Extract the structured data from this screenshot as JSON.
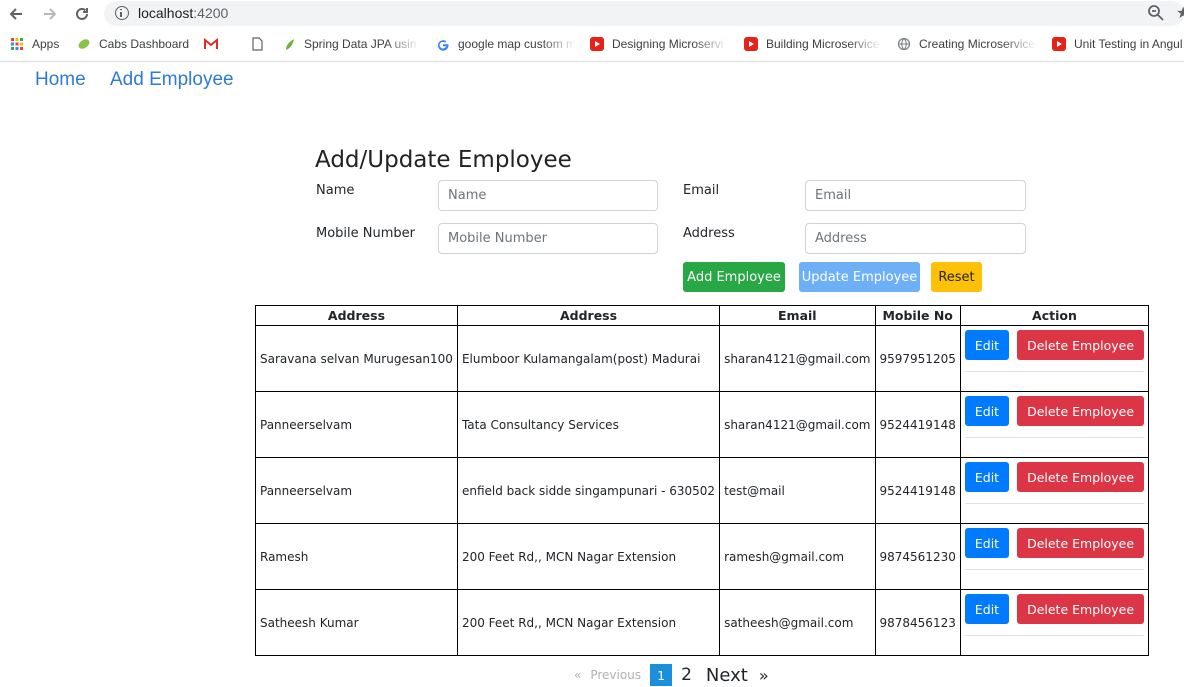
{
  "browser": {
    "url_host": "localhost",
    "url_port": ":4200",
    "bookmarks": [
      {
        "label": "Apps",
        "icon": "apps-grid-icon"
      },
      {
        "label": "Cabs Dashboard",
        "icon": "leaf-icon"
      },
      {
        "label": "",
        "icon": "gmail-icon"
      },
      {
        "label": "",
        "icon": "document-icon"
      },
      {
        "label": "Spring Data JPA usin",
        "icon": "spring-icon"
      },
      {
        "label": "google map custom m",
        "icon": "google-icon"
      },
      {
        "label": "Designing Microservi",
        "icon": "youtube-icon"
      },
      {
        "label": "Building Microservice",
        "icon": "youtube-icon"
      },
      {
        "label": "Creating Microservice",
        "icon": "globe-icon"
      },
      {
        "label": "Unit Testing in Angul",
        "icon": "youtube-icon"
      }
    ]
  },
  "nav": {
    "home": "Home",
    "add_employee": "Add Employee"
  },
  "form": {
    "title": "Add/Update Employee",
    "name_label": "Name",
    "name_placeholder": "Name",
    "email_label": "Email",
    "email_placeholder": "Email",
    "mobile_label": "Mobile Number",
    "mobile_placeholder": "Mobile Number",
    "address_label": "Address",
    "address_placeholder": "Address",
    "add_button": "Add Employee",
    "update_button": "Update Employee",
    "reset_button": "Reset"
  },
  "table": {
    "headers": [
      "Address",
      "Address",
      "Email",
      "Mobile No",
      "Action"
    ],
    "rows": [
      {
        "name": "Saravana selvan Murugesan100",
        "address": "Elumboor Kulamangalam(post) Madurai",
        "email": "sharan4121@gmail.com",
        "mobile": "9597951205"
      },
      {
        "name": "Panneerselvam",
        "address": "Tata Consultancy Services",
        "email": "sharan4121@gmail.com",
        "mobile": "9524419148"
      },
      {
        "name": "Panneerselvam",
        "address": "enfield back sidde singampunari - 630502",
        "email": "test@mail",
        "mobile": "9524419148"
      },
      {
        "name": "Ramesh",
        "address": "200 Feet Rd,, MCN Nagar Extension",
        "email": "ramesh@gmail.com",
        "mobile": "9874561230"
      },
      {
        "name": "Satheesh Kumar",
        "address": "200 Feet Rd,, MCN Nagar Extension",
        "email": "satheesh@gmail.com",
        "mobile": "9878456123"
      }
    ],
    "edit_label": "Edit",
    "delete_label": "Delete Employee"
  },
  "pagination": {
    "prev_arrow": "«",
    "prev_label": "Previous",
    "current": "1",
    "page2": "2",
    "next_label": "Next",
    "next_arrow": "»"
  },
  "colors": {
    "link": "#2e7bd6",
    "success": "#28a745",
    "primary": "#007bff",
    "danger": "#dc3545",
    "warning": "#ffc107"
  }
}
